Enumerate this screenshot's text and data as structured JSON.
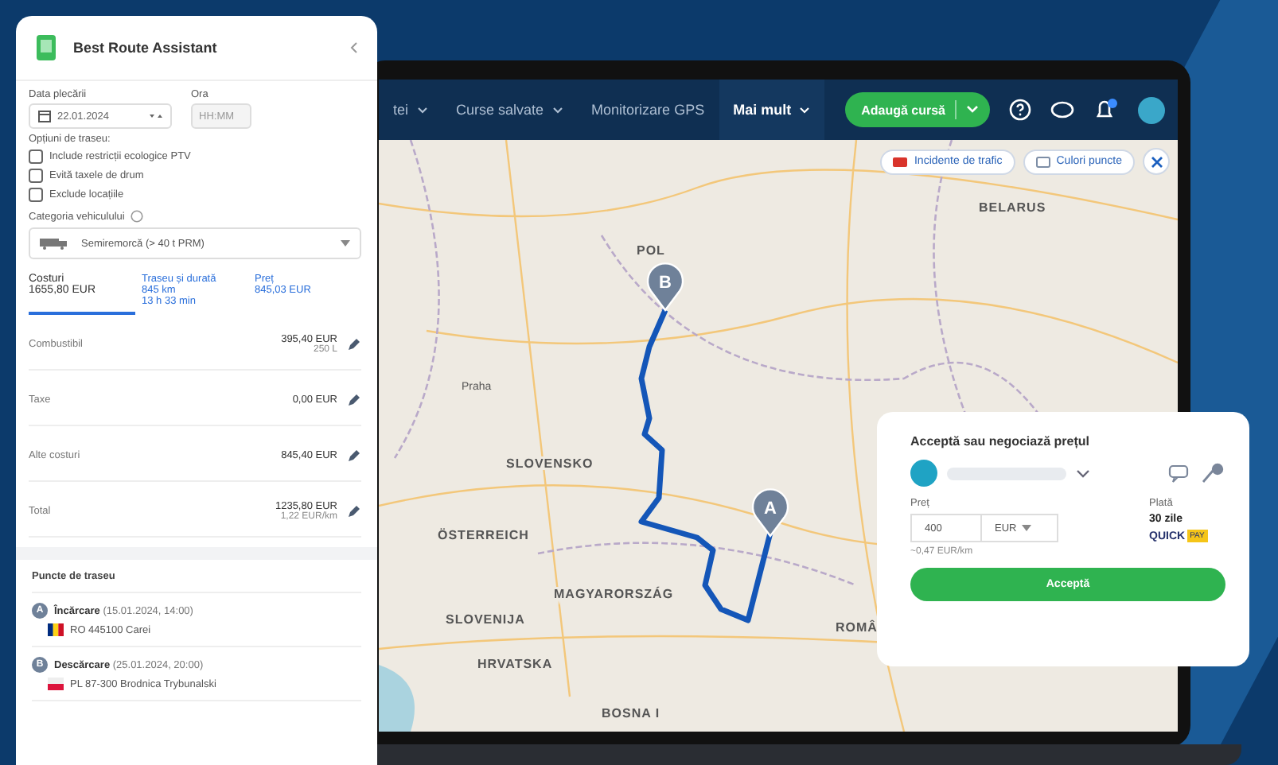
{
  "nav": {
    "items": [
      {
        "label": "tei",
        "selected": false,
        "caret": true
      },
      {
        "label": "Curse salvate",
        "selected": false,
        "caret": true
      },
      {
        "label": "Monitorizare GPS",
        "selected": false,
        "caret": false
      },
      {
        "label": "Mai mult",
        "selected": true,
        "caret": true
      }
    ],
    "add_button": "Adaugă cursă",
    "notification_count_shown": true
  },
  "map": {
    "buttons": [
      "Incidente de trafic",
      "Culori puncte"
    ],
    "labels": [
      {
        "text": "BELARUS",
        "kind": "country"
      },
      {
        "text": "POL",
        "kind": "country"
      },
      {
        "text": "Praha",
        "kind": "city"
      },
      {
        "text": "SLOVENSKO",
        "kind": "country"
      },
      {
        "text": "ÖSTERREICH",
        "kind": "country"
      },
      {
        "text": "MAGYARORSZÁG",
        "kind": "country"
      },
      {
        "text": "SLOVENIJA",
        "kind": "country"
      },
      {
        "text": "HRVATSKA",
        "kind": "country"
      },
      {
        "text": "ROMÂ",
        "kind": "country"
      },
      {
        "text": "BOSNA I",
        "kind": "country"
      }
    ],
    "markers": [
      {
        "letter": "B"
      },
      {
        "letter": "A"
      }
    ]
  },
  "panel": {
    "title": "Best Route Assistant",
    "date_label": "Data plecării",
    "date_value": "22.01.2024",
    "time_label": "Ora",
    "time_placeholder": "HH:MM",
    "options_label": "Opțiuni de traseu:",
    "options": [
      {
        "label": "Include restricții ecologice PTV",
        "checked": false
      },
      {
        "label": "Evită taxele de drum",
        "checked": false
      },
      {
        "label": "Exclude locațiile",
        "checked": false
      }
    ],
    "category_label": "Categoria vehiculului",
    "category_value": "Semiremorcă (> 40 t PRM)",
    "tabs": [
      {
        "lines": [
          "Costuri",
          "1655,80 EUR"
        ],
        "selected": true
      },
      {
        "lines": [
          "Traseu și durată",
          "845 km",
          "13 h 33 min"
        ],
        "selected": false
      },
      {
        "lines": [
          "Preț",
          "845,03 EUR"
        ],
        "selected": false
      }
    ],
    "costs": [
      {
        "label": "Combustibil",
        "value": "395,40 EUR",
        "sub": "250 L"
      },
      {
        "label": "Taxe",
        "value": "0,00 EUR"
      },
      {
        "label": "Alte costuri",
        "value": "845,40 EUR"
      },
      {
        "label": "Total",
        "value": "1235,80 EUR",
        "sub": "1,22 EUR/km"
      }
    ],
    "points_title": "Puncte de traseu",
    "points": [
      {
        "letter": "A",
        "type": "Încărcare",
        "date": "(15.01.2024, 14:00)",
        "kind": "romania",
        "place": "RO 445100 Carei"
      },
      {
        "letter": "B",
        "type": "Descărcare",
        "date": "(25.01.2024, 20:00)",
        "kind": "poland",
        "place": "PL 87-300 Brodnica Trybunalski"
      }
    ]
  },
  "offer": {
    "title": "Acceptă sau negociază prețul",
    "price_label": "Preț",
    "price_value": "400",
    "currency": "EUR",
    "per_km": "~0,47 EUR/km",
    "payment_label": "Plată",
    "payment_value": "30 zile",
    "quick_logo": "QUICK",
    "quick_tag": "PAY",
    "accept_button": "Acceptă"
  }
}
